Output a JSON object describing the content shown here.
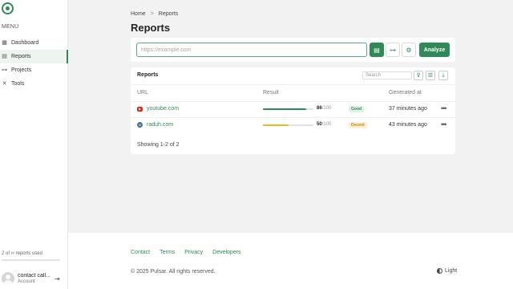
{
  "sidebar": {
    "menu_label": "MENU",
    "items": [
      {
        "label": "Dashboard",
        "icon": "grid-icon",
        "active": false
      },
      {
        "label": "Reports",
        "icon": "reports-icon",
        "active": true
      },
      {
        "label": "Projects",
        "icon": "projects-icon",
        "active": false
      },
      {
        "label": "Tools",
        "icon": "tools-icon",
        "active": false
      }
    ],
    "usage_text": "2 of ∞ reports used",
    "account": {
      "name": "contact call...",
      "role": "Account"
    }
  },
  "breadcrumb": {
    "home": "Home",
    "separator": ">",
    "current": "Reports"
  },
  "page_title": "Reports",
  "analyze": {
    "placeholder": "https://example.com",
    "button_label": "Analyze"
  },
  "reports": {
    "title": "Reports",
    "search_placeholder": "Search",
    "columns": {
      "url": "URL",
      "result": "Result",
      "generated": "Generated at"
    },
    "rows": [
      {
        "url": "youtube.com",
        "favicon": "youtube-icon",
        "score": "86",
        "max": "/100",
        "fraction": 0.86,
        "badge": "Good",
        "badge_type": "good",
        "generated": "37 minutes ago",
        "bar_color": "#2e8b57"
      },
      {
        "url": "raduh.com",
        "favicon": "wordpress-icon",
        "score": "50",
        "max": "/100",
        "fraction": 0.5,
        "badge": "Decent",
        "badge_type": "decent",
        "generated": "43 minutes ago",
        "bar_color": "#f0b429"
      }
    ],
    "showing": "Showing 1-2 of 2"
  },
  "footer": {
    "links": [
      "Contact",
      "Terms",
      "Privacy",
      "Developers"
    ],
    "copyright": "© 2025 Pulsar. All rights reserved.",
    "theme_label": "Light"
  },
  "colors": {
    "accent": "#2e8b57",
    "warning": "#f0b429"
  }
}
